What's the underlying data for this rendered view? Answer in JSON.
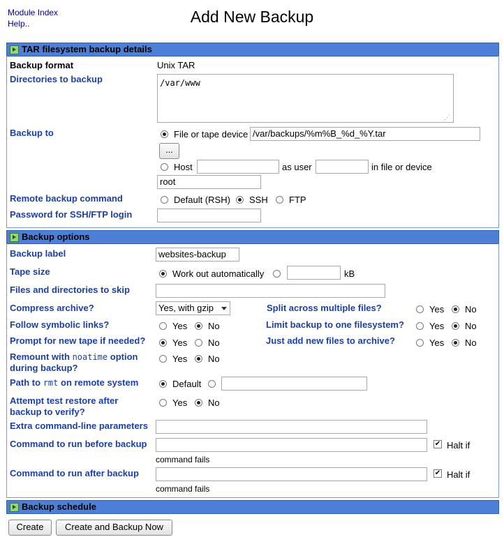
{
  "nav": {
    "module_index": "Module Index",
    "help": "Help.."
  },
  "page_title": "Add New Backup",
  "sections": {
    "tar": "TAR filesystem backup details",
    "options": "Backup options",
    "schedule": "Backup schedule"
  },
  "tar": {
    "format_label": "Backup format",
    "format_value": "Unix TAR",
    "dirs_label": "Directories to backup",
    "dirs_value": "/var/www",
    "backup_to_label": "Backup to",
    "file_option": "File or tape device",
    "file_value": "/var/backups/%m%B_%d_%Y.tar",
    "browse_button": "...",
    "host_option": "Host",
    "as_user": "as user",
    "in_file": "in file or device",
    "user_value": "root",
    "remote_cmd_label": "Remote backup command",
    "remote_default": "Default (RSH)",
    "remote_ssh": "SSH",
    "remote_ftp": "FTP",
    "password_label": "Password for SSH/FTP login"
  },
  "options": {
    "label_label": "Backup label",
    "label_value": "websites-backup",
    "tape_size_label": "Tape size",
    "tape_auto": "Work out automatically",
    "tape_unit": "kB",
    "skip_label": "Files and directories to skip",
    "compress_label": "Compress archive?",
    "compress_value": "Yes, with gzip",
    "split_label": "Split across multiple files?",
    "follow_label": "Follow symbolic links?",
    "limit_label": "Limit backup to one filesystem?",
    "prompt_label": "Prompt for new tape if needed?",
    "justadd_label": "Just add new files to archive?",
    "remount_label_a": "Remount with",
    "remount_code": "noatime",
    "remount_label_b": "option",
    "remount_label_c": "during backup?",
    "rmt_label_a": "Path to",
    "rmt_code": "rmt",
    "rmt_label_b": "on remote system",
    "rmt_default": "Default",
    "test_label_a": "Attempt test restore after",
    "test_label_b": "backup to verify?",
    "extra_label": "Extra command-line parameters",
    "before_label": "Command to run before backup",
    "after_label": "Command to run after backup",
    "halt_if": "Halt if",
    "command_fails": "command fails",
    "yes": "Yes",
    "no": "No"
  },
  "buttons": {
    "create": "Create",
    "create_now": "Create and Backup Now"
  }
}
